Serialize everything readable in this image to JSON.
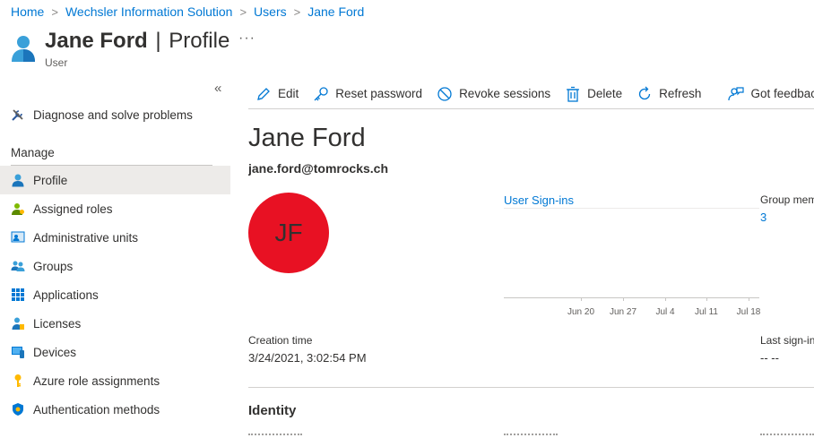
{
  "breadcrumb": [
    "Home",
    "Wechsler Information Solution",
    "Users",
    "Jane Ford"
  ],
  "header": {
    "name": "Jane Ford",
    "separator": "|",
    "page": "Profile",
    "subtitle": "User",
    "more": "···"
  },
  "sidebar": {
    "collapse_glyph": "«",
    "top_items": [
      {
        "label": "Diagnose and solve problems",
        "icon": "wrench-screwdriver-icon"
      }
    ],
    "section_label": "Manage",
    "items": [
      {
        "label": "Profile",
        "icon": "user-icon",
        "active": true
      },
      {
        "label": "Assigned roles",
        "icon": "user-role-icon"
      },
      {
        "label": "Administrative units",
        "icon": "admin-units-icon"
      },
      {
        "label": "Groups",
        "icon": "groups-icon"
      },
      {
        "label": "Applications",
        "icon": "apps-grid-icon"
      },
      {
        "label": "Licenses",
        "icon": "license-icon"
      },
      {
        "label": "Devices",
        "icon": "devices-icon"
      },
      {
        "label": "Azure role assignments",
        "icon": "key-icon"
      },
      {
        "label": "Authentication methods",
        "icon": "shield-icon"
      }
    ]
  },
  "toolbar": {
    "edit": "Edit",
    "reset_password": "Reset password",
    "revoke_sessions": "Revoke sessions",
    "delete": "Delete",
    "refresh": "Refresh",
    "feedback": "Got feedback?"
  },
  "profile": {
    "display_name": "Jane Ford",
    "email": "jane.ford@tomrocks.ch",
    "initials": "JF",
    "avatar_color": "#e81123",
    "signins_label": "User Sign-ins",
    "chart_ticks": [
      "Jun 20",
      "Jun 27",
      "Jul 4",
      "Jul 11",
      "Jul 18"
    ],
    "group_label": "Group mem",
    "group_value": "3",
    "creation_label": "Creation time",
    "creation_value": "3/24/2021, 3:02:54 PM",
    "last_signin_label": "Last sign-in",
    "last_signin_value": "-- --",
    "identity_heading": "Identity"
  },
  "colors": {
    "accent": "#0078d4",
    "active_nav": "#edebe9"
  }
}
